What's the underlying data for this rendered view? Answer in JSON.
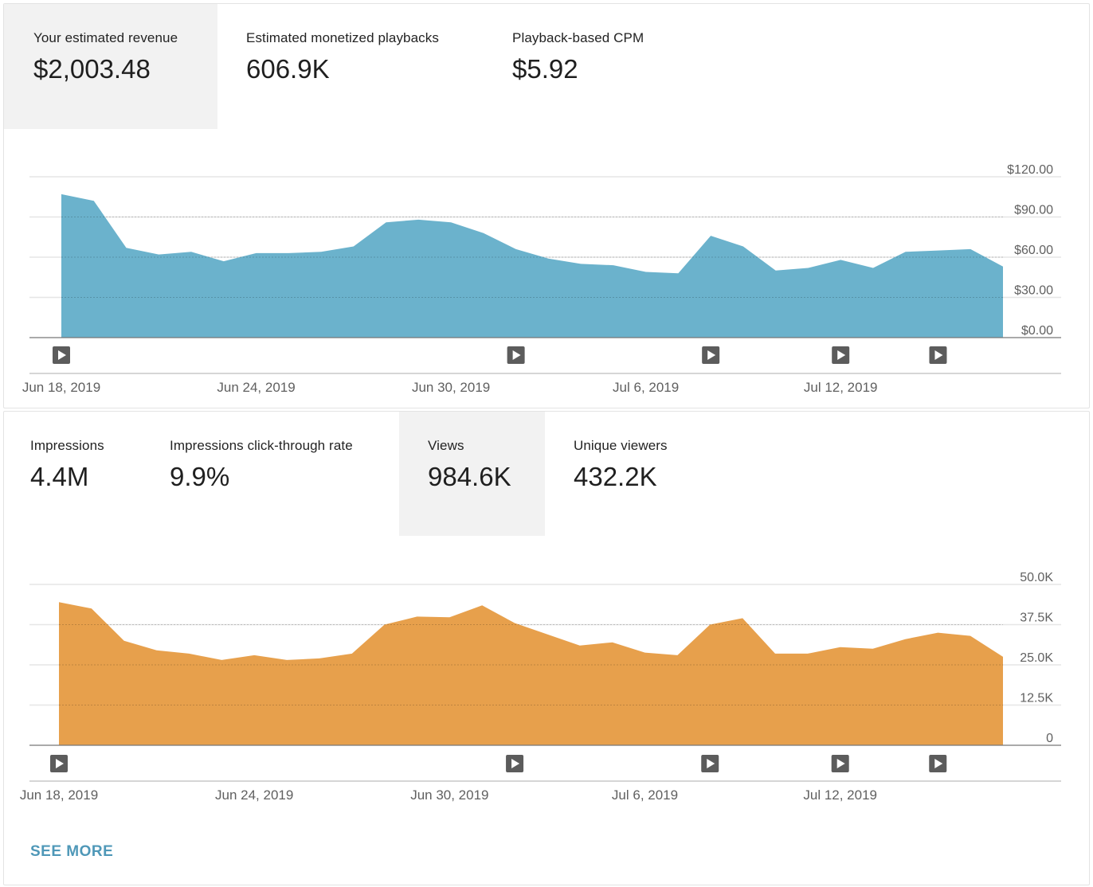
{
  "revenue_card": {
    "metrics": [
      {
        "label": "Your estimated revenue",
        "value": "$2,003.48",
        "selected": true
      },
      {
        "label": "Estimated monetized playbacks",
        "value": "606.9K",
        "selected": false
      },
      {
        "label": "Playback-based CPM",
        "value": "$5.92",
        "selected": false
      }
    ]
  },
  "views_card": {
    "metrics": [
      {
        "label": "Impressions",
        "value": "4.4M",
        "selected": false
      },
      {
        "label": "Impressions click-through rate",
        "value": "9.9%",
        "selected": false
      },
      {
        "label": "Views",
        "value": "984.6K",
        "selected": true
      },
      {
        "label": "Unique viewers",
        "value": "432.2K",
        "selected": false
      }
    ],
    "see_more_label": "SEE MORE"
  },
  "chart_data": [
    {
      "type": "area",
      "color": "#6bb2cc",
      "x_range": [
        "Jun 18, 2019",
        "Jul 17, 2019"
      ],
      "xtick_labels": [
        "Jun 18, 2019",
        "Jun 24, 2019",
        "Jun 30, 2019",
        "Jul 6, 2019",
        "Jul 12, 2019"
      ],
      "ytick_labels": [
        "$0.00",
        "$30.00",
        "$60.00",
        "$90.00",
        "$120.00"
      ],
      "ylim": [
        0,
        120
      ],
      "grid": true,
      "values": [
        107,
        102,
        67,
        62,
        64,
        57,
        63,
        63,
        64,
        68,
        86,
        88,
        86,
        78,
        66,
        59,
        55,
        54,
        49,
        48,
        76,
        68,
        50,
        52,
        58,
        52,
        64,
        65,
        66,
        53
      ],
      "video_marker_days": [
        0,
        14,
        20,
        24,
        27
      ]
    },
    {
      "type": "area",
      "color": "#e7a04c",
      "x_range": [
        "Jun 18, 2019",
        "Jul 17, 2019"
      ],
      "xtick_labels": [
        "Jun 18, 2019",
        "Jun 24, 2019",
        "Jun 30, 2019",
        "Jul 6, 2019",
        "Jul 12, 2019"
      ],
      "ytick_labels": [
        "0",
        "12.5K",
        "25.0K",
        "37.5K",
        "50.0K"
      ],
      "ylim": [
        0,
        50000
      ],
      "grid": true,
      "values": [
        44500,
        42500,
        32500,
        29500,
        28500,
        26500,
        28000,
        26500,
        27000,
        28500,
        37500,
        40000,
        39800,
        43500,
        38000,
        34500,
        31000,
        32000,
        28800,
        28000,
        37500,
        39500,
        28500,
        28500,
        30500,
        30000,
        33000,
        35000,
        34000,
        27500
      ],
      "video_marker_days": [
        0,
        14,
        20,
        24,
        27
      ]
    }
  ]
}
